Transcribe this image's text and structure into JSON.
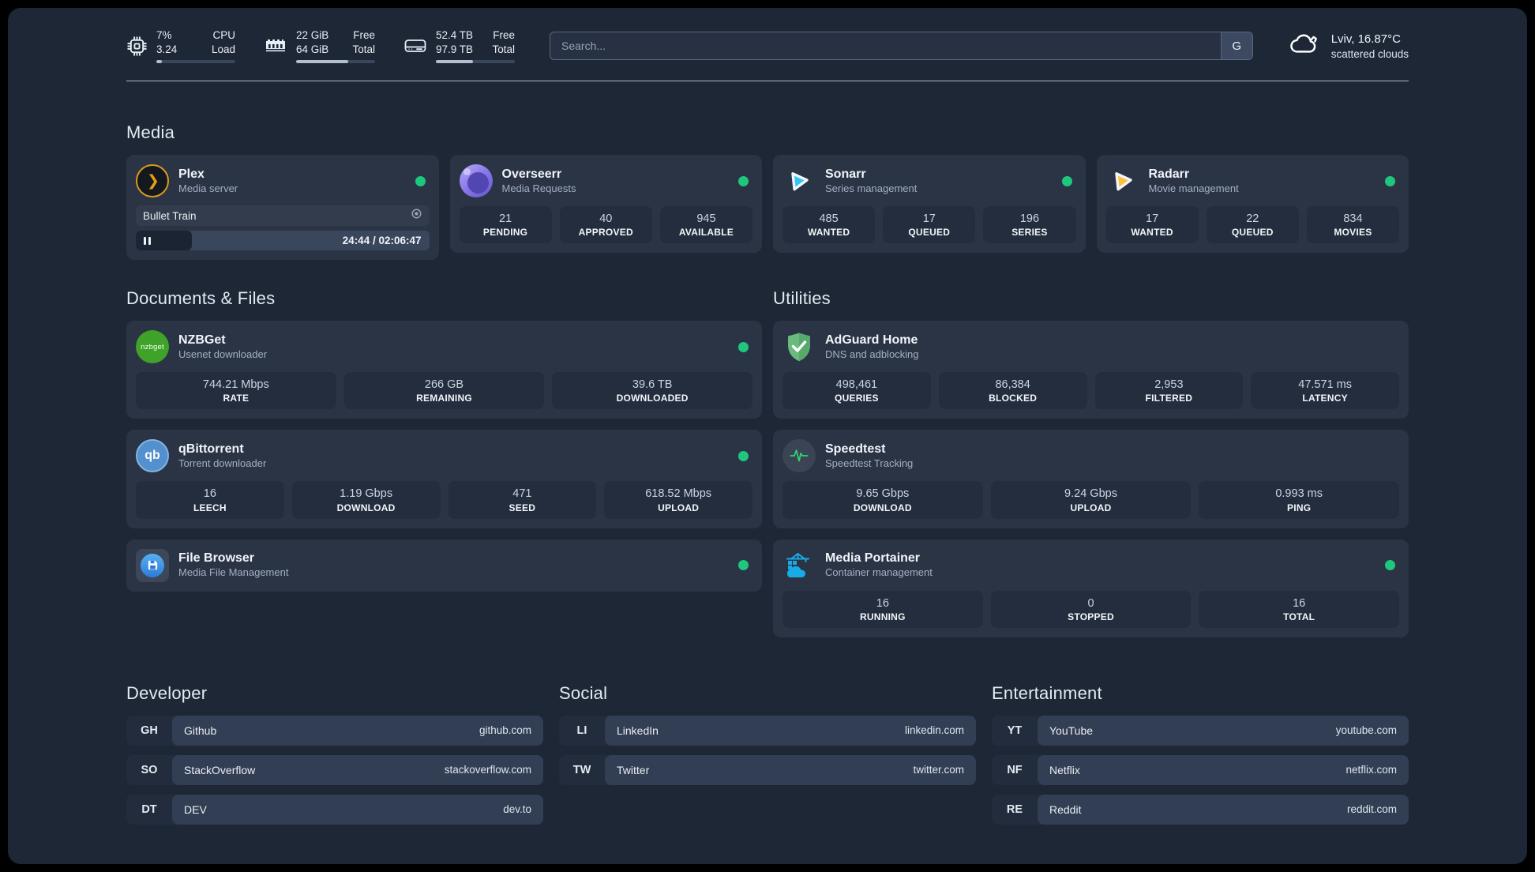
{
  "palette": {
    "background": "#1d2736",
    "card": "#2a3445",
    "stat_box": "#232d3d",
    "online_green": "#1fc77d",
    "plex_gold": "#e5a00d",
    "sonarr_blue": "#33c5f5",
    "radarr_yellow": "#fdc23a",
    "portainer_blue": "#19aae8"
  },
  "header": {
    "stats": [
      {
        "icon": "cpu-icon",
        "rows": [
          {
            "value": "7%",
            "label": "CPU"
          },
          {
            "value": "3.24",
            "label": "Load"
          }
        ],
        "progress": "7%"
      },
      {
        "icon": "ram-icon",
        "rows": [
          {
            "value": "22 GiB",
            "label": "Free"
          },
          {
            "value": "64 GiB",
            "label": "Total"
          }
        ],
        "progress": "66%"
      },
      {
        "icon": "disk-icon",
        "rows": [
          {
            "value": "52.4 TB",
            "label": "Free"
          },
          {
            "value": "97.9 TB",
            "label": "Total"
          }
        ],
        "progress": "47%"
      }
    ],
    "search": {
      "placeholder": "Search...",
      "button_label": "G"
    },
    "weather": {
      "icon": "cloud-icon",
      "location": "Lviv, 16.87°C",
      "condition": "scattered clouds"
    }
  },
  "media": {
    "title": "Media",
    "plex": {
      "icon": "plex-icon",
      "name": "Plex",
      "desc": "Media server",
      "online": true,
      "stream": {
        "title": "Bullet Train",
        "time": "24:44 / 02:06:47",
        "progress": "19%"
      }
    },
    "overseerr": {
      "icon": "overseerr-icon",
      "name": "Overseerr",
      "desc": "Media Requests",
      "online": true,
      "stats": [
        {
          "value": "21",
          "label": "PENDING"
        },
        {
          "value": "40",
          "label": "APPROVED"
        },
        {
          "value": "945",
          "label": "AVAILABLE"
        }
      ]
    },
    "sonarr": {
      "icon": "sonarr-icon",
      "name": "Sonarr",
      "desc": "Series management",
      "online": true,
      "stats": [
        {
          "value": "485",
          "label": "WANTED"
        },
        {
          "value": "17",
          "label": "QUEUED"
        },
        {
          "value": "196",
          "label": "SERIES"
        }
      ]
    },
    "radarr": {
      "icon": "radarr-icon",
      "name": "Radarr",
      "desc": "Movie management",
      "online": true,
      "stats": [
        {
          "value": "17",
          "label": "WANTED"
        },
        {
          "value": "22",
          "label": "QUEUED"
        },
        {
          "value": "834",
          "label": "MOVIES"
        }
      ]
    }
  },
  "documents": {
    "title": "Documents & Files",
    "nzbget": {
      "icon": "nzbget-icon",
      "name": "NZBGet",
      "desc": "Usenet downloader",
      "online": true,
      "stats": [
        {
          "value": "744.21 Mbps",
          "label": "RATE"
        },
        {
          "value": "266 GB",
          "label": "REMAINING"
        },
        {
          "value": "39.6 TB",
          "label": "DOWNLOADED"
        }
      ]
    },
    "qbittorrent": {
      "icon": "qbittorrent-icon",
      "name": "qBittorrent",
      "desc": "Torrent downloader",
      "online": true,
      "stats": [
        {
          "value": "16",
          "label": "LEECH"
        },
        {
          "value": "1.19 Gbps",
          "label": "DOWNLOAD"
        },
        {
          "value": "471",
          "label": "SEED"
        },
        {
          "value": "618.52 Mbps",
          "label": "UPLOAD"
        }
      ]
    },
    "filebrowser": {
      "icon": "filebrowser-icon",
      "name": "File Browser",
      "desc": "Media File Management",
      "online": true
    }
  },
  "utilities": {
    "title": "Utilities",
    "adguard": {
      "icon": "adguard-icon",
      "name": "AdGuard Home",
      "desc": "DNS and adblocking",
      "stats": [
        {
          "value": "498,461",
          "label": "QUERIES"
        },
        {
          "value": "86,384",
          "label": "BLOCKED"
        },
        {
          "value": "2,953",
          "label": "FILTERED"
        },
        {
          "value": "47.571 ms",
          "label": "LATENCY"
        }
      ]
    },
    "speedtest": {
      "icon": "speedtest-icon",
      "name": "Speedtest",
      "desc": "Speedtest Tracking",
      "stats": [
        {
          "value": "9.65 Gbps",
          "label": "DOWNLOAD"
        },
        {
          "value": "9.24 Gbps",
          "label": "UPLOAD"
        },
        {
          "value": "0.993 ms",
          "label": "PING"
        }
      ]
    },
    "portainer": {
      "icon": "portainer-icon",
      "name": "Media Portainer",
      "desc": "Container management",
      "online": true,
      "stats": [
        {
          "value": "16",
          "label": "RUNNING"
        },
        {
          "value": "0",
          "label": "STOPPED"
        },
        {
          "value": "16",
          "label": "TOTAL"
        }
      ]
    }
  },
  "link_sections": [
    {
      "title": "Developer",
      "links": [
        {
          "abbr": "GH",
          "name": "Github",
          "url": "github.com"
        },
        {
          "abbr": "SO",
          "name": "StackOverflow",
          "url": "stackoverflow.com"
        },
        {
          "abbr": "DT",
          "name": "DEV",
          "url": "dev.to"
        }
      ]
    },
    {
      "title": "Social",
      "links": [
        {
          "abbr": "LI",
          "name": "LinkedIn",
          "url": "linkedin.com"
        },
        {
          "abbr": "TW",
          "name": "Twitter",
          "url": "twitter.com"
        }
      ]
    },
    {
      "title": "Entertainment",
      "links": [
        {
          "abbr": "YT",
          "name": "YouTube",
          "url": "youtube.com"
        },
        {
          "abbr": "NF",
          "name": "Netflix",
          "url": "netflix.com"
        },
        {
          "abbr": "RE",
          "name": "Reddit",
          "url": "reddit.com"
        }
      ]
    }
  ]
}
